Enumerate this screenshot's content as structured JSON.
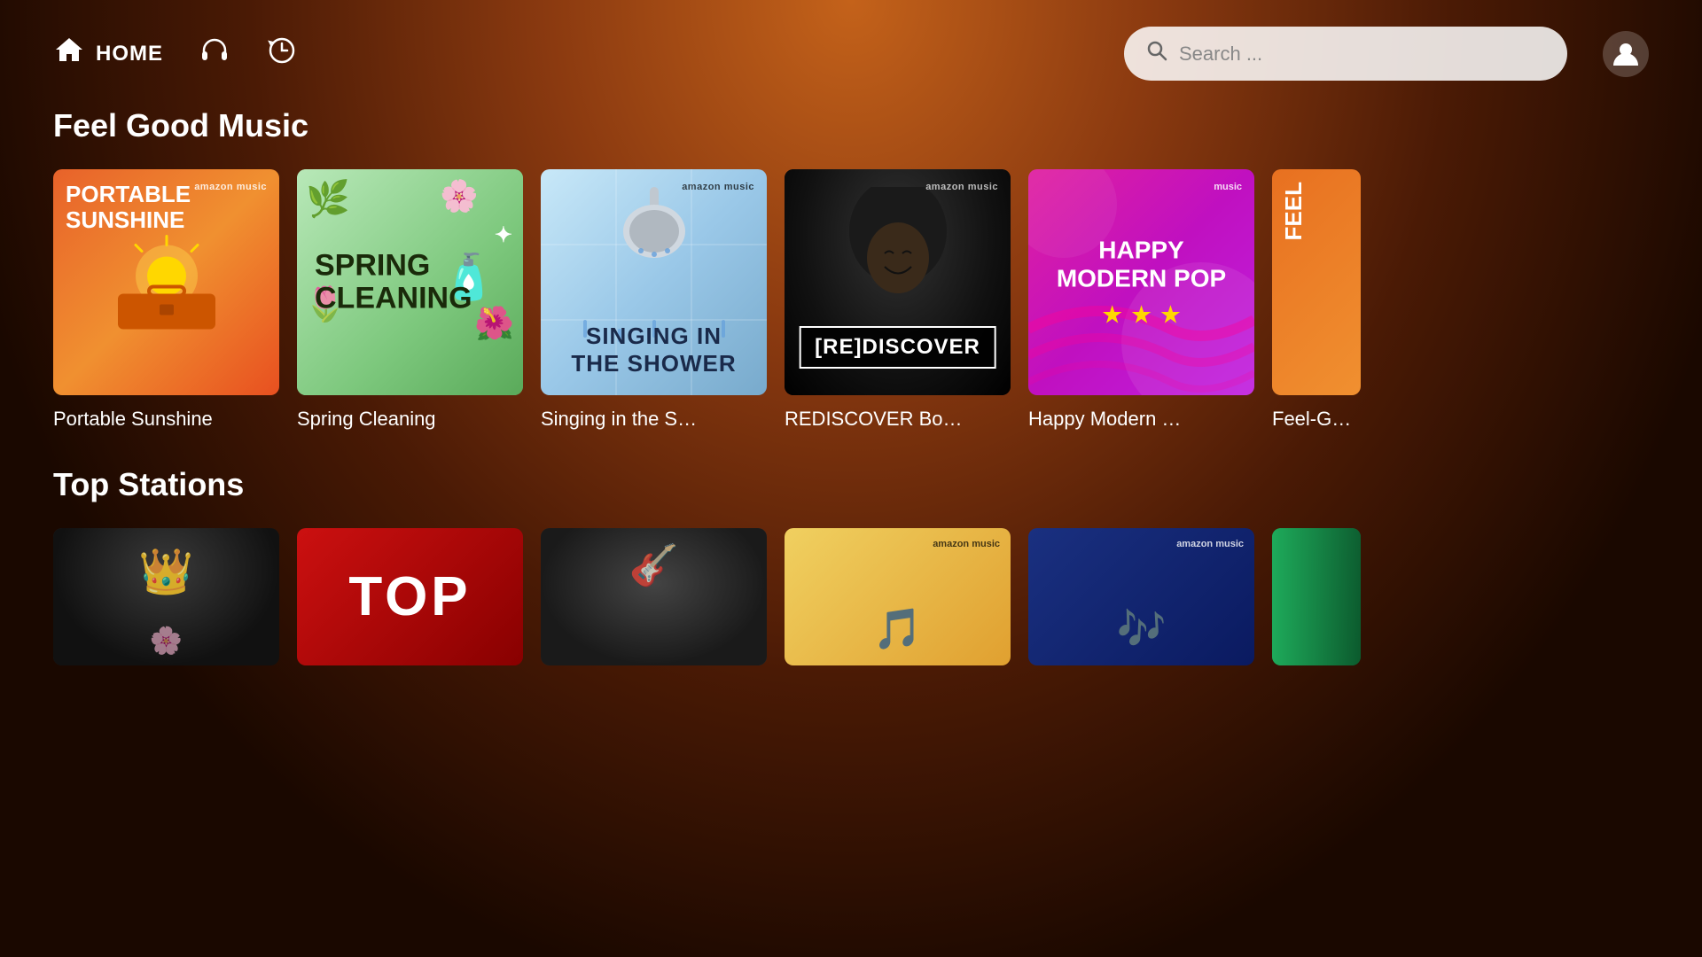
{
  "header": {
    "nav": {
      "home_label": "HOME",
      "headphones_title": "Headphones",
      "history_title": "History"
    },
    "search": {
      "placeholder": "Search ..."
    },
    "profile_title": "Profile"
  },
  "sections": [
    {
      "id": "feel-good-music",
      "title": "Feel Good Music",
      "cards": [
        {
          "id": "portable-sunshine",
          "title_line1": "PORTABLE",
          "title_line2": "SUNSHINE",
          "label": "Portable Sunshine",
          "badge": "amazon music"
        },
        {
          "id": "spring-cleaning",
          "title_line1": "SPRING",
          "title_line2": "CLEANING",
          "label": "Spring Cleaning",
          "badge": "amazon music"
        },
        {
          "id": "singing-shower",
          "title_line1": "SINGING IN",
          "title_line2": "THE SHOWER",
          "label": "Singing in the S…",
          "badge": "amazon music"
        },
        {
          "id": "rediscover",
          "badge_text": "[RE]DISCOVER",
          "label": "REDISCOVER Bo…",
          "badge": "amazon music"
        },
        {
          "id": "happy-modern-pop",
          "title_line1": "HAPPY",
          "title_line2": "MODERN POP",
          "stars": "★ ★ ★",
          "label": "Happy Modern …",
          "badge": "music"
        },
        {
          "id": "feel-good-country",
          "label": "Feel-Go…"
        }
      ]
    },
    {
      "id": "top-stations",
      "title": "Top Stations",
      "cards": [
        {
          "id": "station-1",
          "label": ""
        },
        {
          "id": "station-2",
          "overlay": "TOP",
          "label": ""
        },
        {
          "id": "station-3",
          "label": ""
        },
        {
          "id": "station-4",
          "label": ""
        },
        {
          "id": "station-5",
          "badge": "amazon music",
          "label": ""
        },
        {
          "id": "station-6",
          "label": ""
        }
      ]
    }
  ]
}
